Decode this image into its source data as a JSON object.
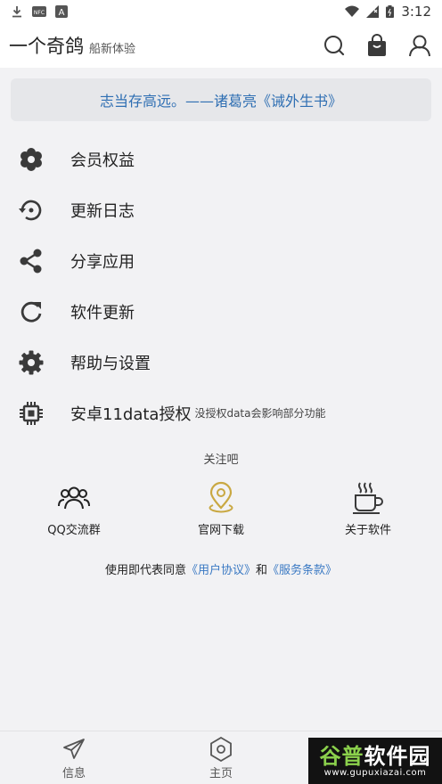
{
  "status_bar": {
    "time": "3:12",
    "left_icons": [
      "download-icon",
      "nfc-badge-icon",
      "a-badge-icon"
    ],
    "right_icons": [
      "wifi-icon",
      "signal-icon",
      "battery-icon"
    ]
  },
  "app_bar": {
    "title": "一个奇鸽",
    "subtitle": "船新体验",
    "actions": [
      "search-icon",
      "shopping-bag-icon",
      "user-icon"
    ]
  },
  "quote": "志当存高远。——诸葛亮《诫外生书》",
  "menu": {
    "items": [
      {
        "label": "会员权益",
        "icon": "flower-icon"
      },
      {
        "label": "更新日志",
        "icon": "history-icon"
      },
      {
        "label": "分享应用",
        "icon": "share-icon"
      },
      {
        "label": "软件更新",
        "icon": "refresh-icon"
      },
      {
        "label": "帮助与设置",
        "icon": "settings-icon"
      },
      {
        "label": "安卓11data授权",
        "icon": "chip-icon",
        "note": "没授权data会影响部分功能"
      }
    ]
  },
  "follow": {
    "title": "关注吧",
    "items": [
      {
        "label": "QQ交流群",
        "icon": "group-icon"
      },
      {
        "label": "官网下载",
        "icon": "location-pin-icon"
      },
      {
        "label": "关于软件",
        "icon": "coffee-cup-icon"
      }
    ]
  },
  "agreement": {
    "prefix": "使用即代表同意",
    "user_agreement": "《用户协议》",
    "and": "和",
    "service_terms": "《服务条款》"
  },
  "bottom_nav": {
    "items": [
      {
        "label": "信息",
        "icon": "send-icon"
      },
      {
        "label": "主页",
        "icon": "hexagon-icon"
      }
    ]
  },
  "watermark": {
    "main_green": "谷普",
    "main_white": "软件园",
    "sub": "www.gupuxiazai.com"
  },
  "colors": {
    "accent": "#2f6fb3",
    "link": "#3a79c3",
    "background": "#f2f2f4",
    "icon": "#3a3a3a",
    "pin": "#c9a842"
  }
}
